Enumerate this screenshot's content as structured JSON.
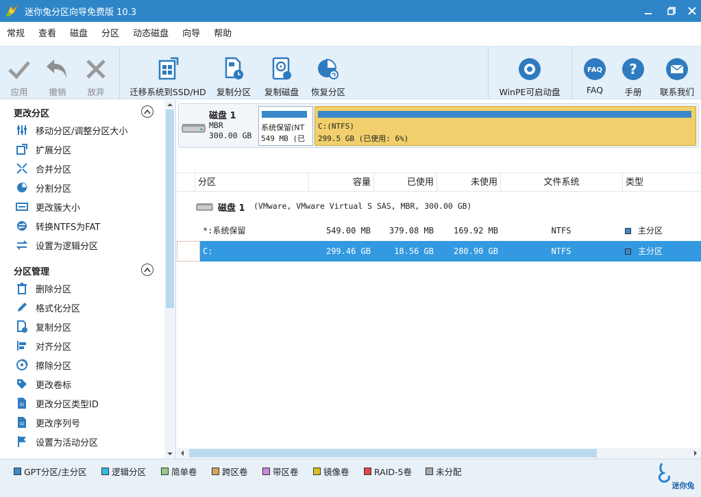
{
  "app": {
    "title": "迷你兔分区向导免费版 10.3"
  },
  "menu": [
    "常规",
    "查看",
    "磁盘",
    "分区",
    "动态磁盘",
    "向导",
    "帮助"
  ],
  "toolbar": {
    "apply": "应用",
    "undo": "撤销",
    "discard": "放弃",
    "migrate_os": "迁移系统到SSD/HD",
    "copy_partition": "复制分区",
    "copy_disk": "复制磁盘",
    "recover_partition": "恢复分区",
    "winpe": "WinPE可启动盘",
    "faq": "FAQ",
    "manual": "手册",
    "contact": "联系我们"
  },
  "left": {
    "section1": "更改分区",
    "section1_items": [
      "移动分区/调整分区大小",
      "扩展分区",
      "合并分区",
      "分割分区",
      "更改簇大小",
      "转换NTFS为FAT",
      "设置为逻辑分区"
    ],
    "section2": "分区管理",
    "section2_items": [
      "删除分区",
      "格式化分区",
      "复制分区",
      "对齐分区",
      "擦除分区",
      "更改卷标",
      "更改分区类型ID",
      "更改序列号",
      "设置为活动分区"
    ]
  },
  "diskmap": {
    "disk_name": "磁盘 1",
    "disk_type": "MBR",
    "disk_size": "300.00 GB",
    "sys_label": "系统保留(NT",
    "sys_size": "549 MB (已",
    "c_label": "C:(NTFS)",
    "c_size": "299.5 GB (已使用: 6%)",
    "c_used_fraction": 0.06
  },
  "grid": {
    "headers": [
      "分区",
      "容量",
      "已使用",
      "未使用",
      "文件系统",
      "类型"
    ],
    "disk_row_name": "磁盘 1",
    "disk_row_desc": "(VMware, VMware Virtual S SAS, MBR, 300.00 GB)",
    "rows": [
      {
        "name": "*:系统保留",
        "capacity": "549.00 MB",
        "used": "379.08 MB",
        "unused": "169.92 MB",
        "fs": "NTFS",
        "type": "主分区"
      },
      {
        "name": "C:",
        "capacity": "299.46 GB",
        "used": "18.56 GB",
        "unused": "280.90 GB",
        "fs": "NTFS",
        "type": "主分区"
      }
    ]
  },
  "legend": {
    "items": [
      {
        "label": "GPT分区/主分区",
        "color": "#3a89c9"
      },
      {
        "label": "逻辑分区",
        "color": "#35b9e0"
      },
      {
        "label": "简单卷",
        "color": "#99cc88"
      },
      {
        "label": "跨区卷",
        "color": "#d9a45a"
      },
      {
        "label": "带区卷",
        "color": "#cc88dd"
      },
      {
        "label": "镜像卷",
        "color": "#d8c020"
      },
      {
        "label": "RAID-5卷",
        "color": "#e04848"
      },
      {
        "label": "未分配",
        "color": "#a8a8a8"
      }
    ],
    "brand": "迷你兔"
  },
  "colors": {
    "titlebar": "#2e86c9",
    "toolbar_bg": "#e3eff9",
    "selected_row": "#3399e0",
    "c_partition": "#f0cf6c"
  }
}
